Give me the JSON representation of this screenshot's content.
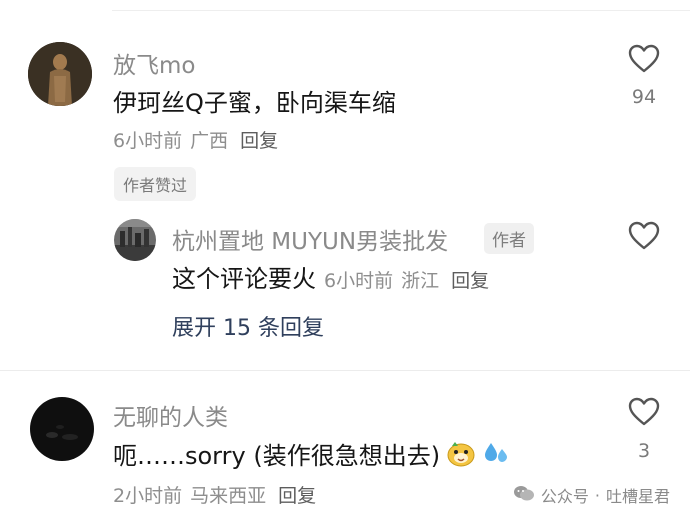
{
  "comments": [
    {
      "username": "放飞mo",
      "text": "伊珂丝Q子蜜，卧向渠车缩",
      "time": "6小时前",
      "location": "广西",
      "reply_label": "回复",
      "like_count": "94",
      "badge": "作者赞过",
      "avatar_icon": "avatar-terracotta-warrior"
    },
    {
      "username": "杭州置地 MUYUN男装批发",
      "author_tag": "作者",
      "text": "这个评论要火",
      "time": "6小时前",
      "location": "浙江",
      "reply_label": "回复",
      "avatar_icon": "avatar-cityscape",
      "expand_label": "展开 15 条回复"
    },
    {
      "username": "无聊的人类",
      "text": "呃……sorry (装作很急想出去)",
      "time": "2小时前",
      "location": "马来西亚",
      "reply_label": "回复",
      "like_count": "3",
      "avatar_icon": "avatar-dark"
    }
  ],
  "watermark": {
    "platform": "公众号",
    "separator": "·",
    "account": "吐槽星君",
    "icon": "wechat-icon"
  },
  "colors": {
    "username": "#8a8a8a",
    "text": "#161616",
    "meta": "#8e8e8e",
    "expand": "#2f3f5c"
  }
}
